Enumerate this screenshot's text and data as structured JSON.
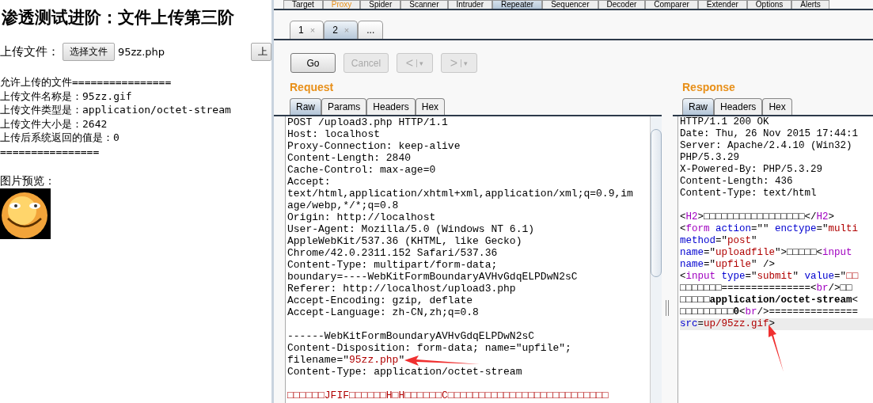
{
  "browser_page": {
    "title": "渗透测试进阶：文件上传第三阶",
    "upload": {
      "label": "上传文件：",
      "choose_button": "选择文件",
      "file_name": "95zz.php",
      "submit_button": "上"
    },
    "result_lines": [
      "允许上传的文件================",
      "上传文件名称是：95zz.gif",
      "上传文件类型是：application/octet-stream",
      "上传文件大小是：2642",
      "上传后系统返回的值是：0",
      "================"
    ],
    "preview_label": "图片预览："
  },
  "burp": {
    "main_tabs": [
      {
        "label": "Target",
        "selected": false,
        "highlighted": false
      },
      {
        "label": "Proxy",
        "selected": false,
        "highlighted": true
      },
      {
        "label": "Spider",
        "selected": false,
        "highlighted": false
      },
      {
        "label": "Scanner",
        "selected": false,
        "highlighted": false
      },
      {
        "label": "Intruder",
        "selected": false,
        "highlighted": false
      },
      {
        "label": "Repeater",
        "selected": true,
        "highlighted": false
      },
      {
        "label": "Sequencer",
        "selected": false,
        "highlighted": false
      },
      {
        "label": "Decoder",
        "selected": false,
        "highlighted": false
      },
      {
        "label": "Comparer",
        "selected": false,
        "highlighted": false
      },
      {
        "label": "Extender",
        "selected": false,
        "highlighted": false
      },
      {
        "label": "Options",
        "selected": false,
        "highlighted": false
      },
      {
        "label": "Alerts",
        "selected": false,
        "highlighted": false
      }
    ],
    "repeater_tabs": [
      {
        "label": "1",
        "close": "×",
        "selected": false
      },
      {
        "label": "2",
        "close": "×",
        "selected": true
      },
      {
        "label": "...",
        "selected": false
      }
    ],
    "buttons": [
      {
        "kind": "text",
        "label": "Go",
        "disabled": false
      },
      {
        "kind": "text",
        "label": "Cancel",
        "disabled": true
      },
      {
        "kind": "nav",
        "label": "<",
        "menu": "▾",
        "disabled": true
      },
      {
        "kind": "nav",
        "label": ">",
        "menu": "▾",
        "disabled": true
      }
    ],
    "request": {
      "title": "Request",
      "tabs": [
        {
          "label": "Raw",
          "selected": true
        },
        {
          "label": "Params",
          "selected": false
        },
        {
          "label": "Headers",
          "selected": false
        },
        {
          "label": "Hex",
          "selected": false
        }
      ],
      "lines": [
        {
          "kind": "plain",
          "text": "POST /upload3.php HTTP/1.1"
        },
        {
          "kind": "plain",
          "text": "Host: localhost"
        },
        {
          "kind": "plain",
          "text": "Proxy-Connection: keep-alive"
        },
        {
          "kind": "plain",
          "text": "Content-Length: 2840"
        },
        {
          "kind": "plain",
          "text": "Cache-Control: max-age=0"
        },
        {
          "kind": "plain",
          "text": "Accept:"
        },
        {
          "kind": "plain",
          "text": "text/html,application/xhtml+xml,application/xml;q=0.9,im"
        },
        {
          "kind": "plain",
          "text": "age/webp,*/*;q=0.8"
        },
        {
          "kind": "plain",
          "text": "Origin: http://localhost"
        },
        {
          "kind": "plain",
          "text": "User-Agent: Mozilla/5.0 (Windows NT 6.1)"
        },
        {
          "kind": "plain",
          "text": "AppleWebKit/537.36 (KHTML, like Gecko)"
        },
        {
          "kind": "plain",
          "text": "Chrome/42.0.2311.152 Safari/537.36"
        },
        {
          "kind": "plain",
          "text": "Content-Type: multipart/form-data;"
        },
        {
          "kind": "plain",
          "text": "boundary=----WebKitFormBoundaryAVHvGdqELPDwN2sC"
        },
        {
          "kind": "plain",
          "text": "Referer: http://localhost/upload3.php"
        },
        {
          "kind": "plain",
          "text": "Accept-Encoding: gzip, deflate"
        },
        {
          "kind": "plain",
          "text": "Accept-Language: zh-CN,zh;q=0.8"
        },
        {
          "kind": "blank"
        },
        {
          "kind": "plain",
          "text": "------WebKitFormBoundaryAVHvGdqELPDwN2sC"
        },
        {
          "kind": "plain",
          "text": "Content-Disposition: form-data; name=\"upfile\";"
        },
        {
          "kind": "mixed",
          "segments": [
            {
              "kind": "text",
              "text": "filename=\""
            },
            {
              "kind": "val",
              "text": "95zz.php"
            },
            {
              "kind": "text",
              "text": "\""
            }
          ],
          "arrow": true
        },
        {
          "kind": "plain",
          "text": "Content-Type: application/octet-stream"
        },
        {
          "kind": "blank"
        },
        {
          "kind": "binary",
          "text": "□□□□□□JFIF□□□□□□H□H□□□□□□C□□□□□□□□□□□□□□□□□□□□□□□□□□"
        }
      ]
    },
    "response": {
      "title": "Response",
      "tabs": [
        {
          "label": "Raw",
          "selected": true
        },
        {
          "label": "Headers",
          "selected": false
        },
        {
          "label": "Hex",
          "selected": false
        }
      ],
      "lines": [
        {
          "kind": "plain",
          "text": "HTTP/1.1 200 OK"
        },
        {
          "kind": "plain",
          "text": "Date: Thu, 26 Nov 2015 17:44:1"
        },
        {
          "kind": "plain",
          "text": "Server: Apache/2.4.10 (Win32)"
        },
        {
          "kind": "plain",
          "text": "PHP/5.3.29"
        },
        {
          "kind": "plain",
          "text": "X-Powered-By: PHP/5.3.29"
        },
        {
          "kind": "plain",
          "text": "Content-Length: 436"
        },
        {
          "kind": "plain",
          "text": "Content-Type: text/html"
        },
        {
          "kind": "blank"
        },
        {
          "kind": "mixed",
          "segments": [
            {
              "kind": "text",
              "text": "<"
            },
            {
              "kind": "tag",
              "text": "H2"
            },
            {
              "kind": "text",
              "text": ">□□□□□□□□□□□□□□□□□</"
            },
            {
              "kind": "tag",
              "text": "H2"
            },
            {
              "kind": "text",
              "text": ">"
            }
          ]
        },
        {
          "kind": "mixed",
          "segments": [
            {
              "kind": "text",
              "text": "<"
            },
            {
              "kind": "tag",
              "text": "form "
            },
            {
              "kind": "attr",
              "text": "action"
            },
            {
              "kind": "text",
              "text": "=\"\" "
            },
            {
              "kind": "attr",
              "text": "enctype"
            },
            {
              "kind": "text",
              "text": "=\""
            },
            {
              "kind": "val",
              "text": "multi"
            }
          ]
        },
        {
          "kind": "mixed",
          "segments": [
            {
              "kind": "attr",
              "text": "method"
            },
            {
              "kind": "text",
              "text": "=\""
            },
            {
              "kind": "val",
              "text": "post"
            },
            {
              "kind": "text",
              "text": "\""
            }
          ]
        },
        {
          "kind": "mixed",
          "segments": [
            {
              "kind": "attr",
              "text": "name"
            },
            {
              "kind": "text",
              "text": "=\""
            },
            {
              "kind": "val",
              "text": "uploadfile"
            },
            {
              "kind": "text",
              "text": "\">□□□□□<"
            },
            {
              "kind": "tag",
              "text": "input"
            }
          ]
        },
        {
          "kind": "mixed",
          "segments": [
            {
              "kind": "attr",
              "text": "name"
            },
            {
              "kind": "text",
              "text": "=\""
            },
            {
              "kind": "val",
              "text": "upfile"
            },
            {
              "kind": "text",
              "text": "\" />"
            }
          ]
        },
        {
          "kind": "mixed",
          "segments": [
            {
              "kind": "text",
              "text": "<"
            },
            {
              "kind": "tag",
              "text": "input "
            },
            {
              "kind": "attr",
              "text": "type"
            },
            {
              "kind": "text",
              "text": "=\""
            },
            {
              "kind": "val",
              "text": "submit"
            },
            {
              "kind": "text",
              "text": "\" "
            },
            {
              "kind": "attr",
              "text": "value"
            },
            {
              "kind": "text",
              "text": "=\""
            },
            {
              "kind": "val",
              "text": "□□"
            }
          ]
        },
        {
          "kind": "mixed",
          "segments": [
            {
              "kind": "text",
              "text": "□□□□□□□===============<"
            },
            {
              "kind": "tag",
              "text": "br"
            },
            {
              "kind": "text",
              "text": "/>□□"
            }
          ]
        },
        {
          "kind": "mixed",
          "segments": [
            {
              "kind": "text",
              "text": "□□□□□"
            },
            {
              "kind": "bold",
              "text": "application/octet-stream"
            },
            {
              "kind": "text",
              "text": "<"
            }
          ]
        },
        {
          "kind": "mixed",
          "segments": [
            {
              "kind": "text",
              "text": "□□□□□□□□□"
            },
            {
              "kind": "bold",
              "text": "0"
            },
            {
              "kind": "text",
              "text": "<"
            },
            {
              "kind": "tag",
              "text": "br"
            },
            {
              "kind": "text",
              "text": "/>==============="
            }
          ]
        },
        {
          "kind": "mixed",
          "highlighted": true,
          "arrow": true,
          "segments": [
            {
              "kind": "attr",
              "text": "src"
            },
            {
              "kind": "text",
              "text": "="
            },
            {
              "kind": "val",
              "text": "up/95zz.gif"
            },
            {
              "kind": "text",
              "text": ">"
            }
          ]
        }
      ]
    }
  }
}
